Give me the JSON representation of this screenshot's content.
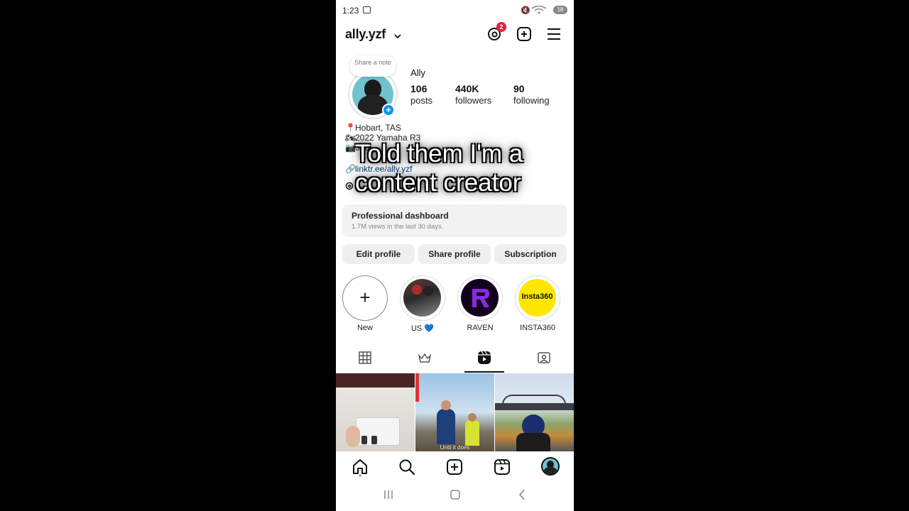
{
  "status": {
    "time": "1:23",
    "battery": "18"
  },
  "header": {
    "username": "ally.yzf",
    "threads_badge": "2"
  },
  "profile": {
    "note": "Share a note",
    "display_name": "Ally",
    "stats": [
      {
        "num": "106",
        "label": "posts"
      },
      {
        "num": "440K",
        "label": "followers"
      },
      {
        "num": "90",
        "label": "following"
      }
    ]
  },
  "bio": {
    "lines": [
      {
        "icon": "📍",
        "text": "Hobart, TAS"
      },
      {
        "icon": "🏍",
        "text": "2022 Yamaha R3"
      },
      {
        "icon": "📷",
        "text": "360"
      }
    ],
    "link": "linktr.ee/ally.yzf"
  },
  "overlay_text": "Told them I'm a content creator",
  "dashboard": {
    "title": "Professional dashboard",
    "subtitle": "1.7M views in the last 30 days."
  },
  "buttons": {
    "edit": "Edit profile",
    "share": "Share profile",
    "subscription": "Subscription"
  },
  "highlights": [
    {
      "label": "New"
    },
    {
      "label": "US 💙"
    },
    {
      "label": "RAVEN"
    },
    {
      "label": "INSTA360"
    }
  ],
  "highlight_logo": "Insta360",
  "grid": {
    "caption2": "Until it does"
  },
  "colors": {
    "accent": "#0095f6",
    "badge": "#e41e3f",
    "insta360_yellow": "#ffe600",
    "raven_purple": "#8a2be2"
  }
}
